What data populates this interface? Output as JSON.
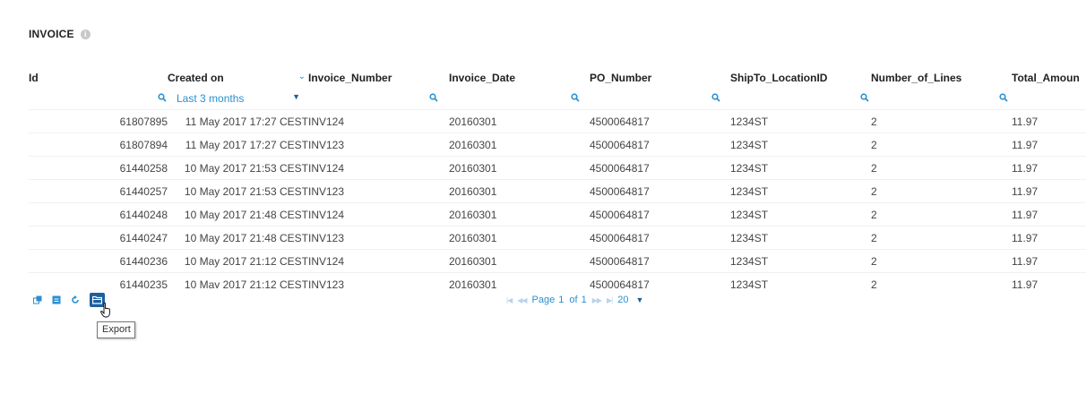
{
  "page": {
    "title": "INVOICE",
    "info_icon": "info-icon"
  },
  "table": {
    "columns": [
      "Id",
      "Created on",
      "Invoice_Number",
      "Invoice_Date",
      "PO_Number",
      "ShipTo_LocationID",
      "Number_of_Lines",
      "Total_Amoun"
    ],
    "filters": {
      "created_on": "Last 3 months"
    },
    "rows": [
      {
        "id": "61807895",
        "created": "11 May 2017 17:27 CEST",
        "invoice_number": "INV124",
        "invoice_date": "20160301",
        "po_number": "4500064817",
        "shipto": "1234ST",
        "lines": "2",
        "total": "11.97"
      },
      {
        "id": "61807894",
        "created": "11 May 2017 17:27 CEST",
        "invoice_number": "INV123",
        "invoice_date": "20160301",
        "po_number": "4500064817",
        "shipto": "1234ST",
        "lines": "2",
        "total": "11.97"
      },
      {
        "id": "61440258",
        "created": "10 May 2017 21:53 CEST",
        "invoice_number": "INV124",
        "invoice_date": "20160301",
        "po_number": "4500064817",
        "shipto": "1234ST",
        "lines": "2",
        "total": "11.97"
      },
      {
        "id": "61440257",
        "created": "10 May 2017 21:53 CEST",
        "invoice_number": "INV123",
        "invoice_date": "20160301",
        "po_number": "4500064817",
        "shipto": "1234ST",
        "lines": "2",
        "total": "11.97"
      },
      {
        "id": "61440248",
        "created": "10 May 2017 21:48 CEST",
        "invoice_number": "INV124",
        "invoice_date": "20160301",
        "po_number": "4500064817",
        "shipto": "1234ST",
        "lines": "2",
        "total": "11.97"
      },
      {
        "id": "61440247",
        "created": "10 May 2017 21:48 CEST",
        "invoice_number": "INV123",
        "invoice_date": "20160301",
        "po_number": "4500064817",
        "shipto": "1234ST",
        "lines": "2",
        "total": "11.97"
      },
      {
        "id": "61440236",
        "created": "10 May 2017 21:12 CEST",
        "invoice_number": "INV124",
        "invoice_date": "20160301",
        "po_number": "4500064817",
        "shipto": "1234ST",
        "lines": "2",
        "total": "11.97"
      },
      {
        "id": "61440235",
        "created": "10 May 2017 21:12 CEST",
        "invoice_number": "INV123",
        "invoice_date": "20160301",
        "po_number": "4500064817",
        "shipto": "1234ST",
        "lines": "2",
        "total": "11.97"
      }
    ]
  },
  "toolbar": {
    "buttons": [
      "restore-columns-icon",
      "select-columns-icon",
      "refresh-icon",
      "export-icon"
    ],
    "tooltip": "Export"
  },
  "pager": {
    "page_label": "Page",
    "page": "1",
    "of_label": "of",
    "total_pages": "1",
    "page_size": "20"
  },
  "colors": {
    "accent": "#2a8fd0",
    "export_button": "#1b5fa0",
    "pager_disabled": "#b9d3ec"
  }
}
